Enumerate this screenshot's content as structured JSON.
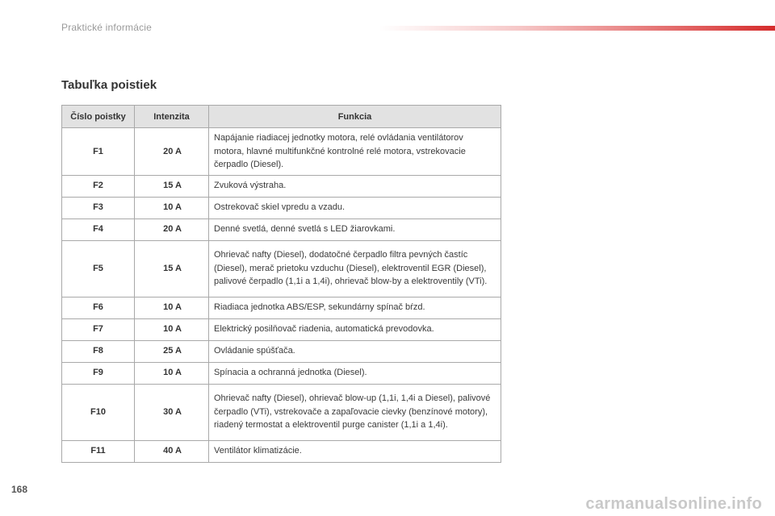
{
  "header": {
    "title": "Praktické informácie",
    "accent_color": "#d52b2b"
  },
  "section": {
    "title": "Tabuľka poistiek"
  },
  "table": {
    "columns": [
      "Číslo poistky",
      "Intenzita",
      "Funkcia"
    ],
    "rows": [
      {
        "number": "F1",
        "ampere": "20 A",
        "function": "Napájanie riadiacej jednotky motora, relé ovládania ventilátorov motora, hlavné multifunkčné kontrolné relé motora, vstrekovacie čerpadlo (Diesel)."
      },
      {
        "number": "F2",
        "ampere": "15 A",
        "function": "Zvuková výstraha."
      },
      {
        "number": "F3",
        "ampere": "10 A",
        "function": "Ostrekovač skiel vpredu a vzadu."
      },
      {
        "number": "F4",
        "ampere": "20 A",
        "function": "Denné svetlá, denné svetlá s LED žiarovkami."
      },
      {
        "number": "F5",
        "ampere": "15 A",
        "function": "Ohrievač nafty (Diesel), dodatočné čerpadlo filtra pevných častíc (Diesel), merač prietoku vzduchu (Diesel), elektroventil EGR (Diesel), palivové čerpadlo (1,1i a 1,4i), ohrievač blow-by a elektroventily (VTi)."
      },
      {
        "number": "F6",
        "ampere": "10 A",
        "function": "Riadiaca jednotka ABS/ESP, sekundárny spínač bŕzd."
      },
      {
        "number": "F7",
        "ampere": "10 A",
        "function": "Elektrický posilňovač riadenia, automatická prevodovka."
      },
      {
        "number": "F8",
        "ampere": "25 A",
        "function": "Ovládanie spúšťača."
      },
      {
        "number": "F9",
        "ampere": "10 A",
        "function": "Spínacia a ochranná jednotka (Diesel)."
      },
      {
        "number": "F10",
        "ampere": "30 A",
        "function": "Ohrievač nafty (Diesel), ohrievač blow-up (1,1i, 1,4i a Diesel), palivové čerpadlo (VTi), vstrekovače a zapaľovacie cievky (benzínové motory), riadený termostat a elektroventil purge canister (1,1i a 1,4i)."
      },
      {
        "number": "F11",
        "ampere": "40 A",
        "function": "Ventilátor klimatizácie."
      }
    ]
  },
  "footer": {
    "page_number": "168",
    "watermark": "carmanualsonline.info"
  }
}
